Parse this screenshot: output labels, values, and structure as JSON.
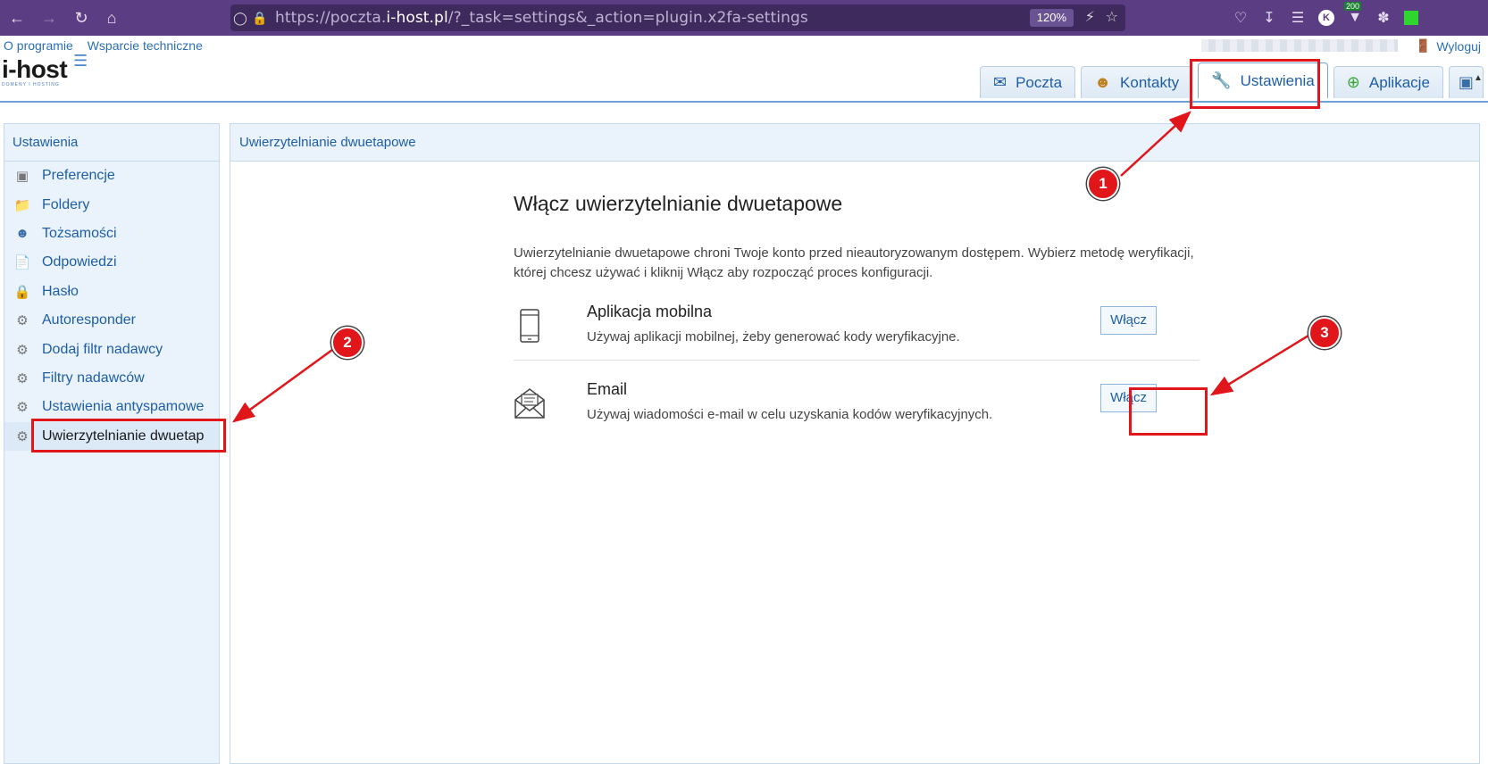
{
  "browser": {
    "url_prefix": "https://poczta.",
    "url_domain": "i-host.pl",
    "url_path": "/?_task=settings&_action=plugin.x2fa-settings",
    "zoom": "120%",
    "extension_badge": "200",
    "profile_initial": "K"
  },
  "top_links": [
    "O programie",
    "Wsparcie techniczne"
  ],
  "logout_label": "Wyloguj",
  "logo": {
    "text": "i-host",
    "subtitle": "DOMENY I HOSTING"
  },
  "tabs": [
    {
      "label": "Poczta",
      "icon": "mail-icon"
    },
    {
      "label": "Kontakty",
      "icon": "contacts-icon"
    },
    {
      "label": "Ustawienia",
      "icon": "wrench-icon",
      "active": true
    },
    {
      "label": "Aplikacje",
      "icon": "plus-circle-icon"
    }
  ],
  "sidebar": {
    "title": "Ustawienia",
    "items": [
      {
        "label": "Preferencje",
        "icon": "monitor-icon"
      },
      {
        "label": "Foldery",
        "icon": "folder-icon"
      },
      {
        "label": "Tożsamości",
        "icon": "user-icon"
      },
      {
        "label": "Odpowiedzi",
        "icon": "document-icon"
      },
      {
        "label": "Hasło",
        "icon": "lock-icon"
      },
      {
        "label": "Autoresponder",
        "icon": "gear-icon"
      },
      {
        "label": "Dodaj filtr nadawcy",
        "icon": "gear-icon"
      },
      {
        "label": "Filtry nadawców",
        "icon": "gear-icon"
      },
      {
        "label": "Ustawienia antyspamowe",
        "icon": "gear-icon"
      },
      {
        "label": "Uwierzytelnianie dwuetap",
        "icon": "gear-icon",
        "selected": true
      }
    ]
  },
  "content": {
    "header": "Uwierzytelnianie dwuetapowe",
    "title": "Włącz uwierzytelnianie dwuetapowe",
    "description": "Uwierzytelnianie dwuetapowe chroni Twoje konto przed nieautoryzowanym dostępem. Wybierz metodę weryfikacji, której chcesz używać i kliknij Włącz aby rozpocząć proces konfiguracji.",
    "methods": [
      {
        "title": "Aplikacja mobilna",
        "description": "Używaj aplikacji mobilnej, żeby generować kody weryfikacyjne.",
        "button": "Włącz",
        "icon": "phone-icon"
      },
      {
        "title": "Email",
        "description": "Używaj wiadomości e-mail w celu uzyskania kodów weryfikacyjnych.",
        "button": "Włącz",
        "icon": "envelope-icon"
      }
    ]
  },
  "annotations": [
    "1",
    "2",
    "3"
  ],
  "colors": {
    "accent": "#1e5ea6",
    "annotation": "#e0161b",
    "browser_bar": "#5a3d82"
  }
}
